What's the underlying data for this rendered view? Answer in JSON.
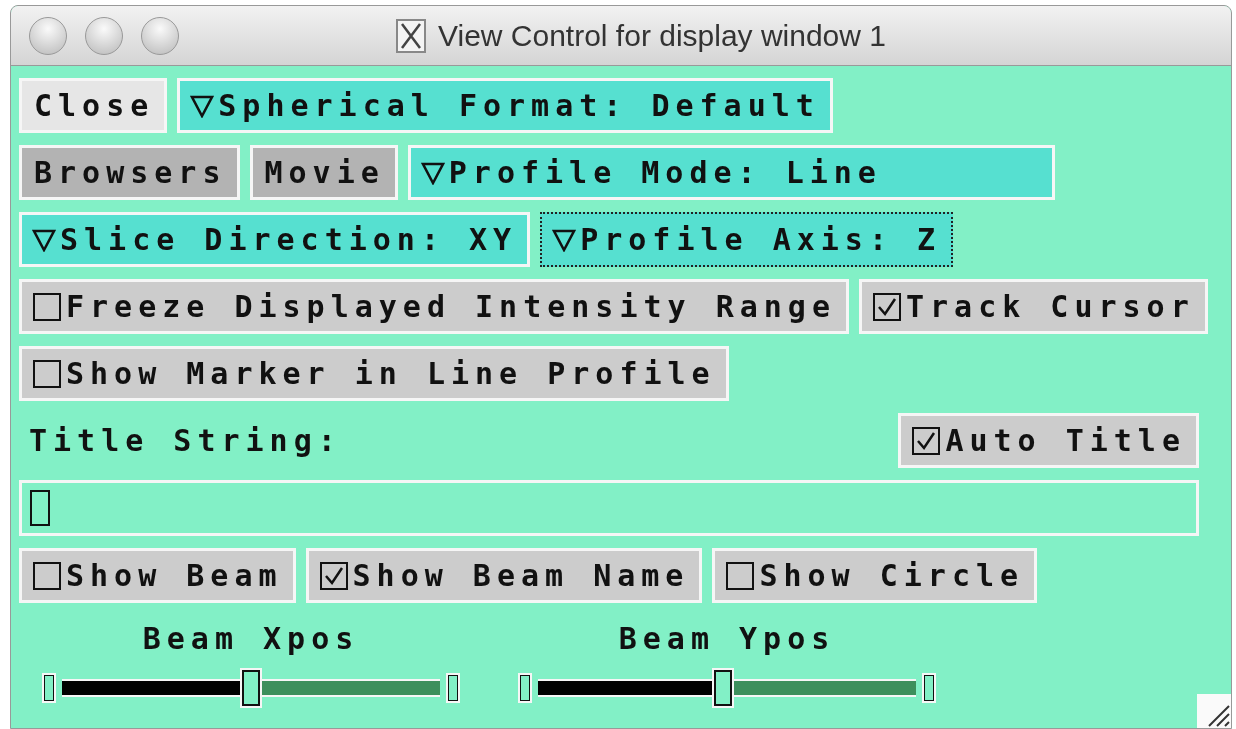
{
  "window": {
    "title": "View Control for display window 1"
  },
  "controls": [
    [
      {
        "kind": "button",
        "label": "Close",
        "color": "#e6e6e6"
      },
      {
        "kind": "dropdown",
        "label": "Spherical Format: Default",
        "focused": false
      }
    ],
    [
      {
        "kind": "button",
        "label": "Browsers",
        "color": "#b3b3b3"
      },
      {
        "kind": "button",
        "label": "Movie",
        "color": "#b3b3b3"
      },
      {
        "kind": "dropdown",
        "label": "Profile Mode: Line",
        "focused": false
      }
    ],
    [
      {
        "kind": "dropdown",
        "label": "Slice Direction: XY",
        "focused": false
      },
      {
        "kind": "dropdown",
        "label": "Profile Axis: Z",
        "focused": true
      }
    ],
    [
      {
        "kind": "checkbox",
        "label": "Freeze Displayed Intensity Range",
        "checked": false
      },
      {
        "kind": "checkbox",
        "label": "Track Cursor",
        "checked": true
      }
    ],
    [
      {
        "kind": "checkbox",
        "label": "Show Marker in Line Profile",
        "checked": false
      }
    ]
  ],
  "title_string": {
    "label": "Title String:",
    "auto_title": {
      "label": "Auto Title",
      "checked": true
    }
  },
  "beam_options": [
    {
      "label": "Show Beam",
      "checked": false
    },
    {
      "label": "Show Beam Name",
      "checked": true
    },
    {
      "label": "Show Circle",
      "checked": false
    }
  ],
  "sliders": [
    {
      "label": "Beam Xpos",
      "level": 0.5
    },
    {
      "label": "Beam Ypos",
      "level": 0.49
    }
  ]
}
